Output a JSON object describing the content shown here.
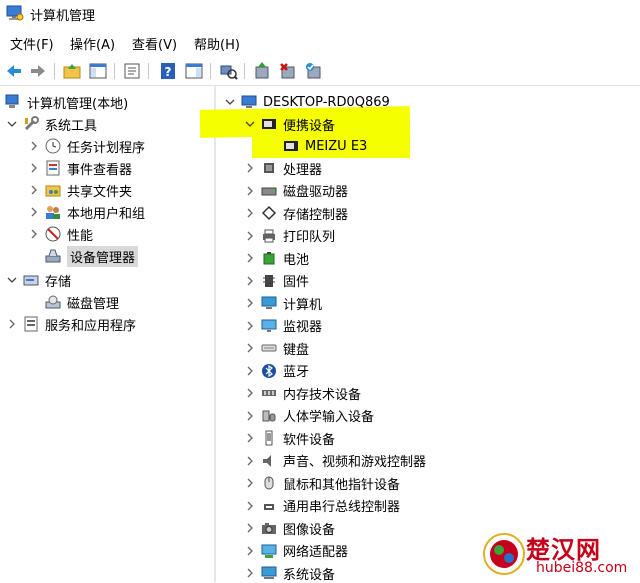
{
  "window": {
    "title": "计算机管理"
  },
  "menu": [
    {
      "label": "文件(F)"
    },
    {
      "label": "操作(A)"
    },
    {
      "label": "查看(V)"
    },
    {
      "label": "帮助(H)"
    }
  ],
  "left_tree": {
    "root": "计算机管理(本地)",
    "system_tools": "系统工具",
    "task_scheduler": "任务计划程序",
    "event_viewer": "事件查看器",
    "shared_folders": "共享文件夹",
    "local_users": "本地用户和组",
    "performance": "性能",
    "device_manager": "设备管理器",
    "storage": "存储",
    "disk_management": "磁盘管理",
    "services": "服务和应用程序"
  },
  "devices": {
    "computer": "DESKTOP-RD0Q869",
    "portable": "便携设备",
    "portable_child": "MEIZU E3",
    "items": [
      {
        "label": "处理器",
        "icon": "cpu-icon"
      },
      {
        "label": "磁盘驱动器",
        "icon": "disk-drive-icon"
      },
      {
        "label": "存储控制器",
        "icon": "storage-controller-icon"
      },
      {
        "label": "打印队列",
        "icon": "printer-icon"
      },
      {
        "label": "电池",
        "icon": "battery-icon"
      },
      {
        "label": "固件",
        "icon": "firmware-icon"
      },
      {
        "label": "计算机",
        "icon": "computer-icon"
      },
      {
        "label": "监视器",
        "icon": "monitor-icon"
      },
      {
        "label": "键盘",
        "icon": "keyboard-icon"
      },
      {
        "label": "蓝牙",
        "icon": "bluetooth-icon"
      },
      {
        "label": "内存技术设备",
        "icon": "memory-icon"
      },
      {
        "label": "人体学输入设备",
        "icon": "hid-icon"
      },
      {
        "label": "软件设备",
        "icon": "software-device-icon"
      },
      {
        "label": "声音、视频和游戏控制器",
        "icon": "sound-icon"
      },
      {
        "label": "鼠标和其他指针设备",
        "icon": "mouse-icon"
      },
      {
        "label": "通用串行总线控制器",
        "icon": "usb-icon"
      },
      {
        "label": "图像设备",
        "icon": "camera-icon"
      },
      {
        "label": "网络适配器",
        "icon": "network-icon"
      },
      {
        "label": "系统设备",
        "icon": "system-device-icon"
      }
    ]
  },
  "watermark": {
    "brand": "楚汉网",
    "url": "hubei88.com"
  },
  "colors": {
    "highlight": "#f5ff00",
    "accent": "#2a6fc9",
    "selected": "#d9d9d9"
  }
}
